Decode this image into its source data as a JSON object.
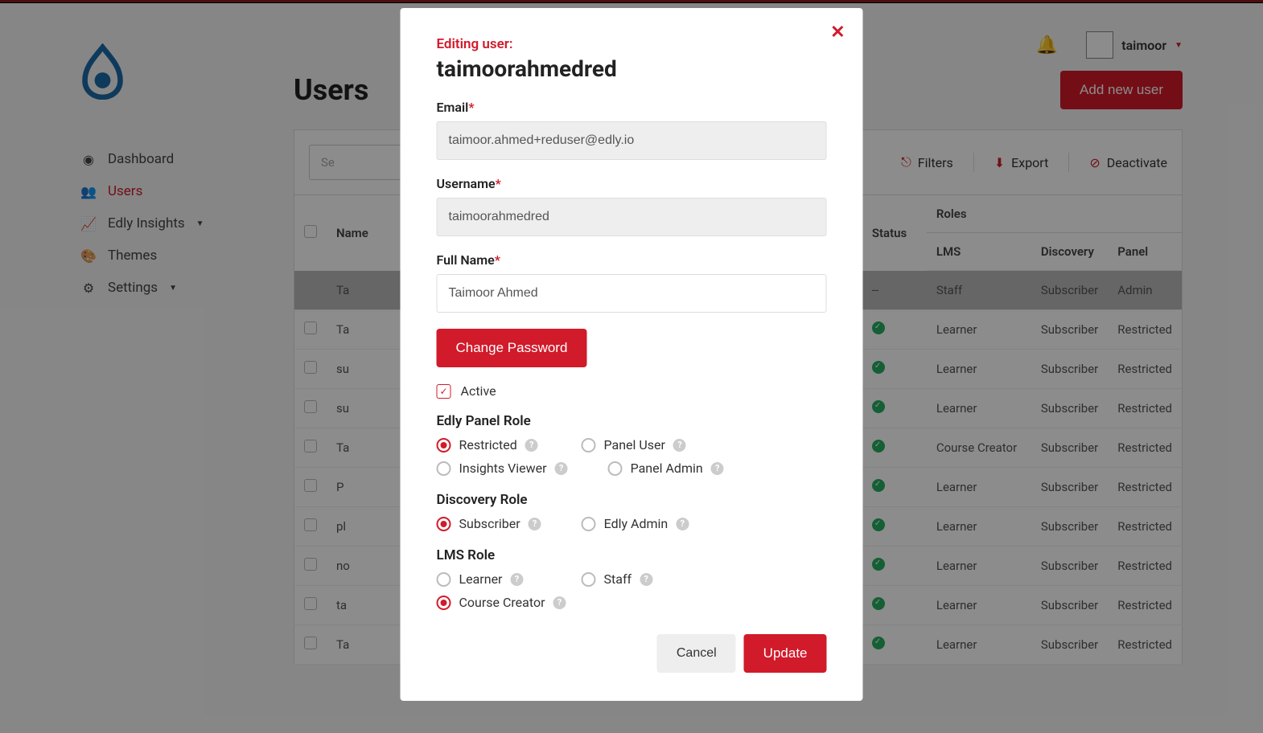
{
  "header": {
    "username": "taimoor"
  },
  "sidebar": {
    "items": [
      {
        "label": "Dashboard"
      },
      {
        "label": "Users"
      },
      {
        "label": "Edly Insights"
      },
      {
        "label": "Themes"
      },
      {
        "label": "Settings"
      }
    ]
  },
  "page": {
    "title": "Users",
    "add_button": "Add new user",
    "search_placeholder": "Search"
  },
  "toolbar_actions": {
    "filters": "Filters",
    "export": "Export",
    "deactivate": "Deactivate"
  },
  "table": {
    "headers": {
      "name": "Name",
      "status": "Status",
      "roles": "Roles",
      "lms": "LMS",
      "discovery": "Discovery",
      "panel": "Panel"
    },
    "rows": [
      {
        "name": "Ta",
        "status": "--",
        "lms": "Staff",
        "discovery": "Subscriber",
        "panel": "Admin",
        "highlight": true
      },
      {
        "name": "Ta",
        "status": "ok",
        "lms": "Learner",
        "discovery": "Subscriber",
        "panel": "Restricted"
      },
      {
        "name": "su",
        "status": "ok",
        "lms": "Learner",
        "discovery": "Subscriber",
        "panel": "Restricted"
      },
      {
        "name": "su",
        "status": "ok",
        "lms": "Learner",
        "discovery": "Subscriber",
        "panel": "Restricted"
      },
      {
        "name": "Ta",
        "status": "ok",
        "lms": "Course Creator",
        "discovery": "Subscriber",
        "panel": "Restricted"
      },
      {
        "name": "P",
        "status": "ok",
        "lms": "Learner",
        "discovery": "Subscriber",
        "panel": "Restricted"
      },
      {
        "name": "pl",
        "status": "ok",
        "lms": "Learner",
        "discovery": "Subscriber",
        "panel": "Restricted"
      },
      {
        "name": "no",
        "status": "ok",
        "lms": "Learner",
        "discovery": "Subscriber",
        "panel": "Restricted"
      },
      {
        "name": "ta",
        "status": "ok",
        "lms": "Learner",
        "discovery": "Subscriber",
        "panel": "Restricted"
      },
      {
        "name": "Ta",
        "status": "ok",
        "lms": "Learner",
        "discovery": "Subscriber",
        "panel": "Restricted"
      }
    ]
  },
  "modal": {
    "subtitle": "Editing user:",
    "title": "taimoorahmedred",
    "email_label": "Email",
    "email_value": "taimoor.ahmed+reduser@edly.io",
    "username_label": "Username",
    "username_value": "taimoorahmedred",
    "fullname_label": "Full Name",
    "fullname_value": "Taimoor Ahmed",
    "change_password": "Change Password",
    "active_label": "Active",
    "panel_role_label": "Edly Panel Role",
    "panel_roles": [
      "Restricted",
      "Panel User",
      "Insights Viewer",
      "Panel Admin"
    ],
    "panel_selected": "Restricted",
    "discovery_role_label": "Discovery Role",
    "discovery_roles": [
      "Subscriber",
      "Edly Admin"
    ],
    "discovery_selected": "Subscriber",
    "lms_role_label": "LMS Role",
    "lms_roles": [
      "Learner",
      "Staff",
      "Course Creator"
    ],
    "lms_selected": "Course Creator",
    "cancel": "Cancel",
    "update": "Update"
  }
}
